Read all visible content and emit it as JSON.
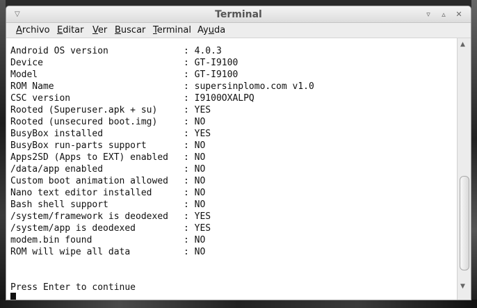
{
  "window": {
    "title": "Terminal"
  },
  "titlebar": {
    "menu_glyph": "▽",
    "minimize_glyph": "▿",
    "maximize_glyph": "▵",
    "close_glyph": "✕"
  },
  "menubar": {
    "items": [
      {
        "label": "Archivo",
        "mnemonic": "A",
        "rest": "rchivo"
      },
      {
        "label": "Editar",
        "mnemonic": "E",
        "rest": "ditar"
      },
      {
        "label": "Ver",
        "mnemonic": "V",
        "rest": "er"
      },
      {
        "label": "Buscar",
        "mnemonic": "B",
        "rest": "uscar"
      },
      {
        "label": "Terminal",
        "mnemonic": "T",
        "rest": "erminal"
      },
      {
        "label": "Ayuda",
        "pre": "Ay",
        "mnemonic": "u",
        "rest": "da"
      }
    ]
  },
  "terminal": {
    "lines": [
      {
        "label": "Android OS version",
        "value": ": 4.0.3"
      },
      {
        "label": "Device",
        "value": ": GT-I9100"
      },
      {
        "label": "Model",
        "value": ": GT-I9100"
      },
      {
        "label": "ROM Name",
        "value": ": supersinplomo.com v1.0"
      },
      {
        "label": "CSC version",
        "value": ": I9100OXALPQ"
      },
      {
        "label": "Rooted (Superuser.apk + su)",
        "value": ": YES"
      },
      {
        "label": "Rooted (unsecured boot.img)",
        "value": ": NO"
      },
      {
        "label": "BusyBox installed",
        "value": ": YES"
      },
      {
        "label": "BusyBox run-parts support",
        "value": ": NO"
      },
      {
        "label": "Apps2SD (Apps to EXT) enabled",
        "value": ": NO"
      },
      {
        "label": "/data/app enabled",
        "value": ": NO"
      },
      {
        "label": "Custom boot animation allowed",
        "value": ": NO"
      },
      {
        "label": "Nano text editor installed",
        "value": ": NO"
      },
      {
        "label": "Bash shell support",
        "value": ": NO"
      },
      {
        "label": "/system/framework is deodexed",
        "value": ": YES"
      },
      {
        "label": "/system/app is deodexed",
        "value": ": YES"
      },
      {
        "label": "modem.bin found",
        "value": ": NO"
      },
      {
        "label": "ROM will wipe all data",
        "value": ": NO"
      }
    ],
    "prompt": "Press Enter to continue"
  },
  "scrollbar": {
    "up_glyph": "▲",
    "down_glyph": "▼",
    "position": 0.92
  }
}
